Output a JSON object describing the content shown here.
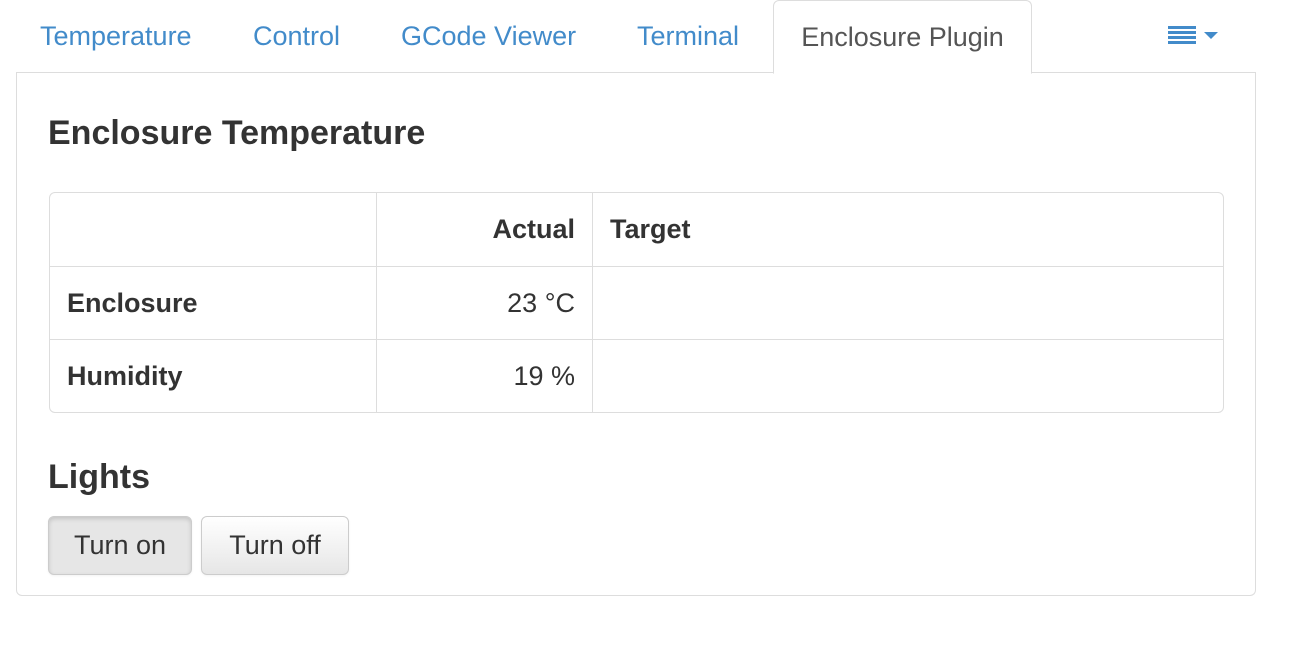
{
  "tabs": [
    {
      "label": "Temperature"
    },
    {
      "label": "Control"
    },
    {
      "label": "GCode Viewer"
    },
    {
      "label": "Terminal"
    },
    {
      "label": "Enclosure Plugin",
      "active": true
    }
  ],
  "tab_menu_icon": "list-menu-icon",
  "enclosure": {
    "title": "Enclosure Temperature",
    "table": {
      "headers": [
        "",
        "Actual",
        "Target"
      ],
      "rows": [
        {
          "label": "Enclosure",
          "actual": "23 °C",
          "target": ""
        },
        {
          "label": "Humidity",
          "actual": "19 %",
          "target": ""
        }
      ]
    }
  },
  "lights": {
    "title": "Lights",
    "turn_on_label": "Turn on",
    "turn_off_label": "Turn off"
  },
  "colors": {
    "link": "#428bca",
    "text": "#333333",
    "border": "#dddddd"
  }
}
